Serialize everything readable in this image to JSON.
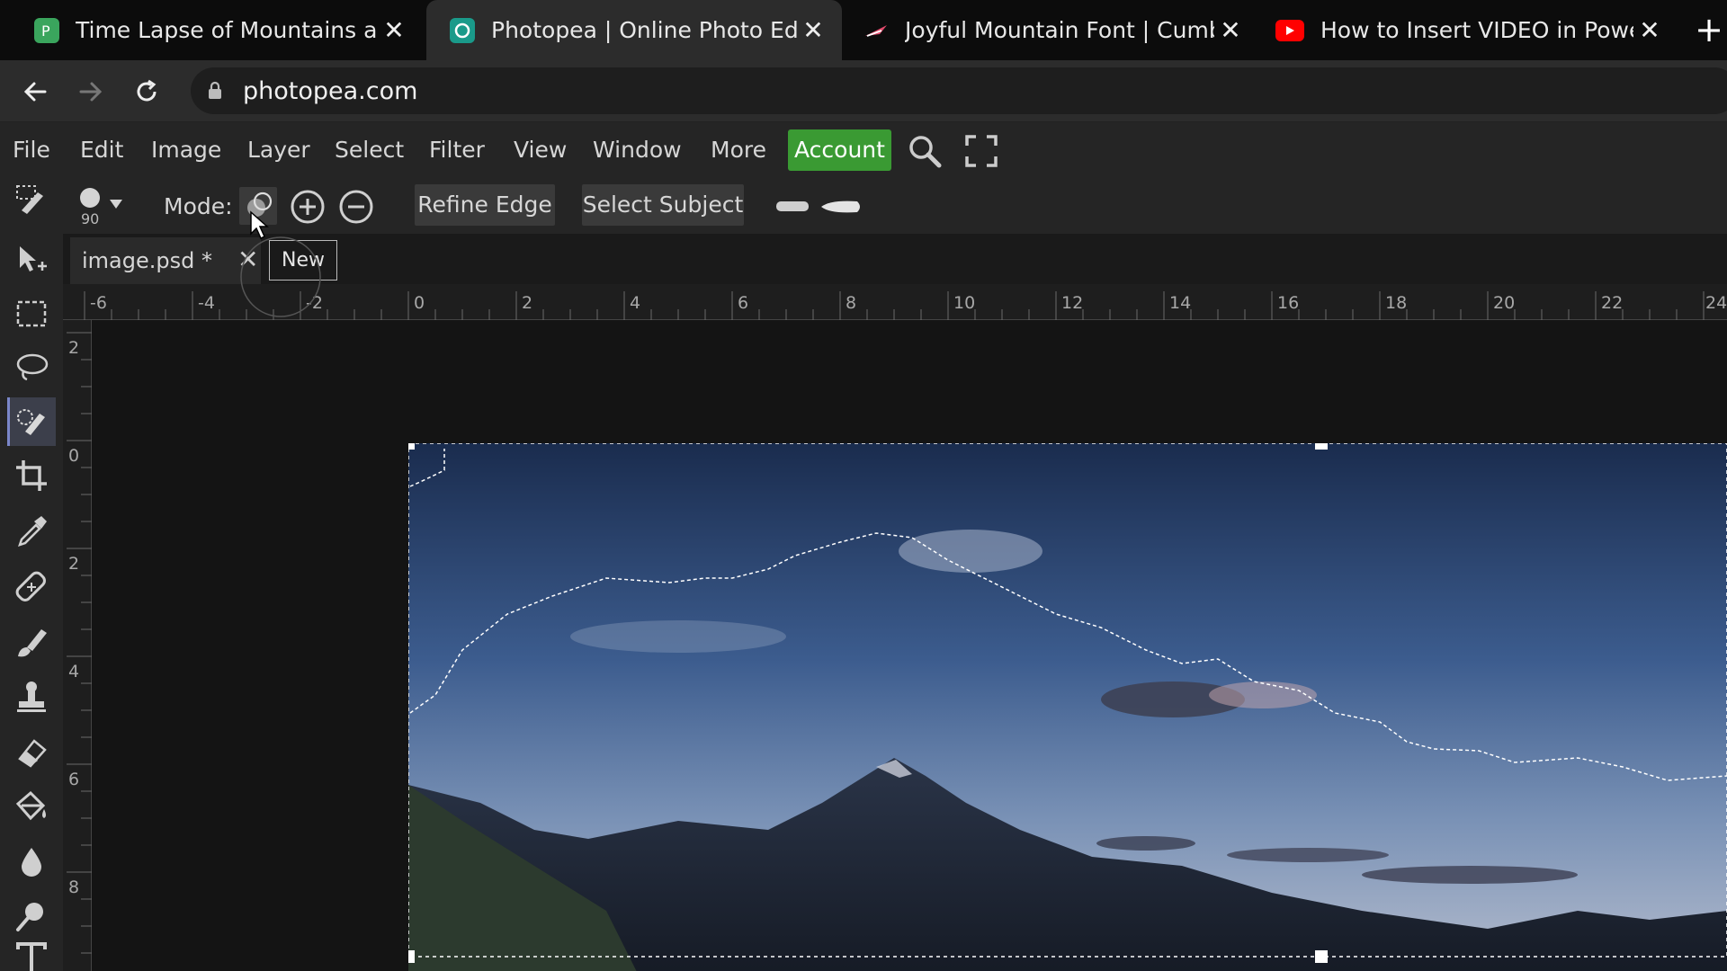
{
  "browser": {
    "tabs": [
      {
        "title": "Time Lapse of Mountains at Suns",
        "active": false,
        "favicon_color": "#3aa55d"
      },
      {
        "title": "Photopea | Online Photo Editor",
        "active": true,
        "favicon_color": "#1a9a8a"
      },
      {
        "title": "Joyful Mountain Font | Cumberla",
        "active": false,
        "favicon_color": "#e24a6c"
      },
      {
        "title": "How to Insert VIDEO in PowerPoi",
        "active": false,
        "favicon_color": "#ff0000"
      }
    ],
    "url": "photopea.com"
  },
  "menu": {
    "items": [
      "File",
      "Edit",
      "Image",
      "Layer",
      "Select",
      "Filter",
      "View",
      "Window",
      "More"
    ],
    "account_label": "Account",
    "account_color": "#3a9a33"
  },
  "options": {
    "brush_size": "90",
    "mode_label": "Mode:",
    "refine_edge_label": "Refine Edge",
    "select_subject_label": "Select Subject"
  },
  "document": {
    "tab_title": "image.psd *",
    "tooltip": "New"
  },
  "rulers": {
    "top_labels": [
      "-6",
      "-4",
      "-2",
      "0",
      "2",
      "4",
      "6",
      "8",
      "10",
      "12",
      "14",
      "16",
      "18",
      "20",
      "22",
      "24"
    ],
    "left_labels": [
      "2",
      "0",
      "2",
      "4",
      "6",
      "8"
    ]
  },
  "tools": [
    "move-tool-icon",
    "marquee-tool-icon",
    "lasso-tool-icon",
    "quick-selection-tool-icon",
    "crop-tool-icon",
    "eyedropper-tool-icon",
    "healing-brush-tool-icon",
    "brush-tool-icon",
    "clone-stamp-tool-icon",
    "eraser-tool-icon",
    "paint-bucket-tool-icon",
    "blur-tool-icon",
    "dodge-tool-icon",
    "type-tool-icon"
  ]
}
